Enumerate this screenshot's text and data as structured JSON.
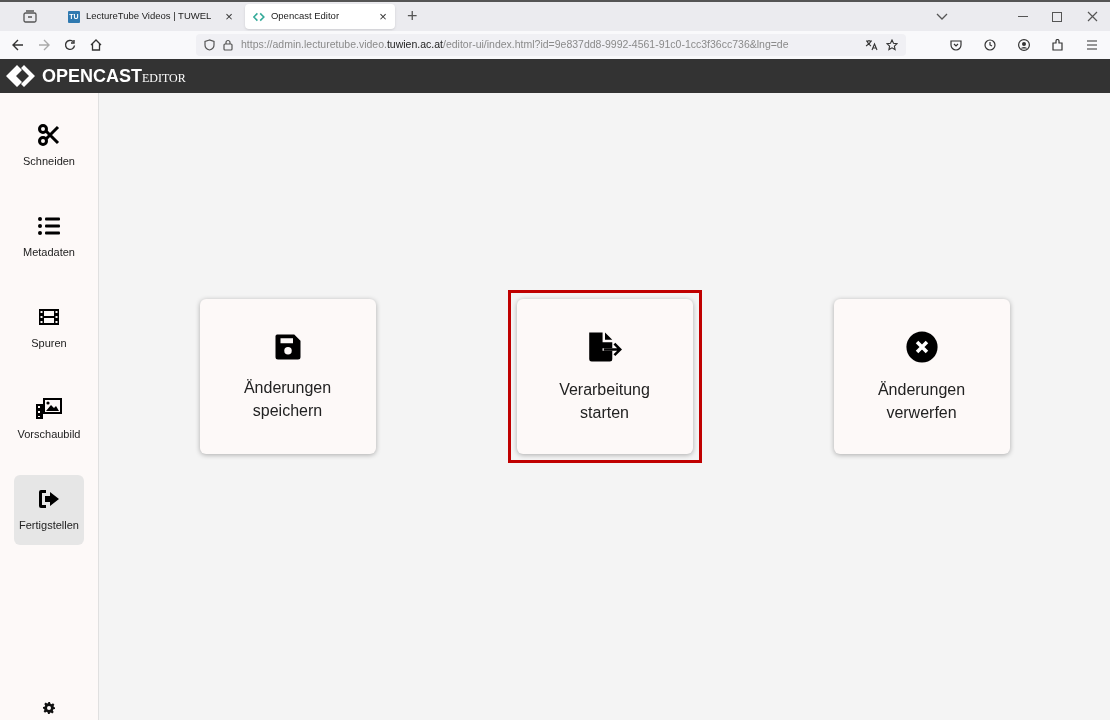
{
  "browser": {
    "tabs": [
      {
        "kind": "tu",
        "favicon_text": "TU",
        "label": "LectureTube Videos | TUWEL",
        "close": "×",
        "selected": false
      },
      {
        "kind": "opencast",
        "label": "Opencast Editor",
        "close": "×",
        "selected": true
      }
    ],
    "new_tab": "+",
    "url": "https://admin.lecturetube.video.**tuwien.ac.at**/editor-ui/index.html?id=9e837dd8-9992-4561-91c0-1cc3f36cc736&lng=de"
  },
  "app_header": {
    "logo_main": "OPENCAST",
    "logo_sub": "EDITOR"
  },
  "sidebar": {
    "items": [
      {
        "kind": "scissors",
        "label": "Schneiden",
        "selected": false
      },
      {
        "kind": "list",
        "label": "Metadaten",
        "selected": false
      },
      {
        "kind": "film",
        "label": "Spuren",
        "selected": false
      },
      {
        "kind": "images",
        "label": "Vorschaubild",
        "selected": false
      },
      {
        "kind": "exit",
        "label": "Fertigstellen",
        "selected": true
      }
    ]
  },
  "actions": [
    {
      "kind": "save",
      "label": "Änderungen speichern",
      "highlighted": false
    },
    {
      "kind": "export",
      "label": "Verarbeitung starten",
      "highlighted": true
    },
    {
      "kind": "discard",
      "label": "Änderungen verwerfen",
      "highlighted": false
    }
  ]
}
